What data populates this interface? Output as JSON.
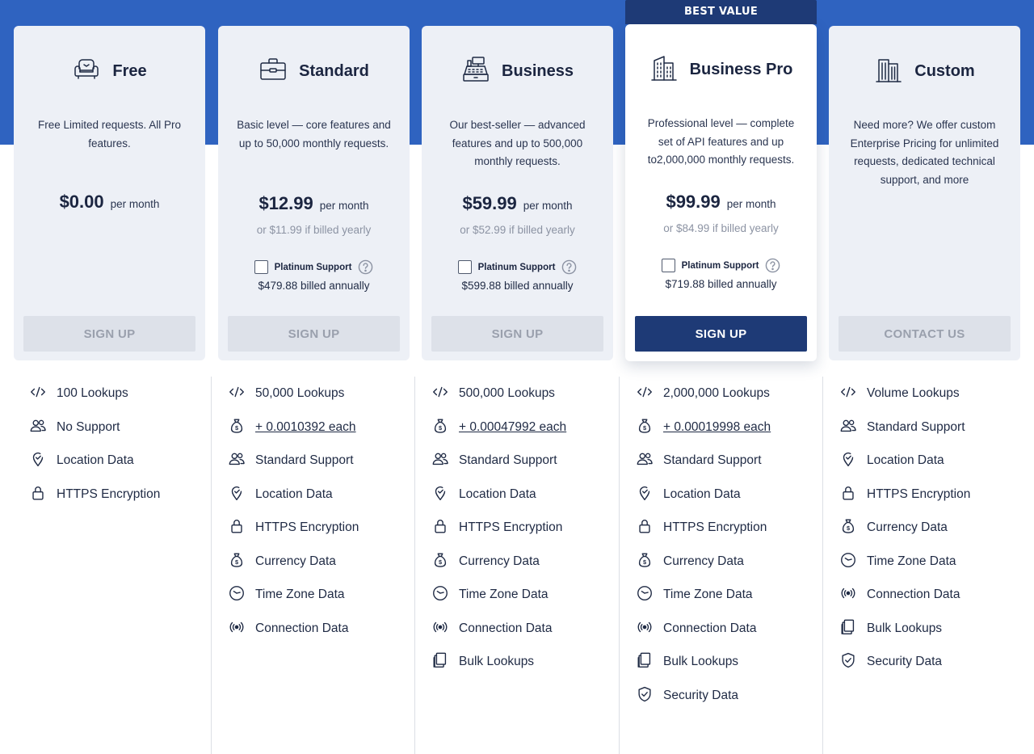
{
  "banner": {
    "best_value": "BEST VALUE"
  },
  "plans": [
    {
      "name": "Free",
      "icon": "armchair-icon",
      "description": "Free Limited requests. All Pro features.",
      "price": "$0.00",
      "period": "per month",
      "yearly": "",
      "support_label": "",
      "annual": "",
      "button": "SIGN UP",
      "features": [
        {
          "icon": "code-icon",
          "text": "100 Lookups"
        },
        {
          "icon": "users-icon",
          "text": "No Support"
        },
        {
          "icon": "location-icon",
          "text": "Location Data"
        },
        {
          "icon": "lock-icon",
          "text": "HTTPS Encryption"
        }
      ]
    },
    {
      "name": "Standard",
      "icon": "briefcase-icon",
      "description": "Basic level — core features and up to 50,000 monthly requests.",
      "price": "$12.99",
      "period": "per month",
      "yearly": "or $11.99 if billed yearly",
      "support_label": "Platinum Support",
      "annual": "$479.88 billed annually",
      "button": "SIGN UP",
      "features": [
        {
          "icon": "code-icon",
          "text": "50,000 Lookups"
        },
        {
          "icon": "money-bag-icon",
          "text": "+ 0.0010392 each",
          "link": true
        },
        {
          "icon": "users-icon",
          "text": "Standard Support"
        },
        {
          "icon": "location-icon",
          "text": "Location Data"
        },
        {
          "icon": "lock-icon",
          "text": "HTTPS Encryption"
        },
        {
          "icon": "money-bag-icon",
          "text": "Currency Data"
        },
        {
          "icon": "clock-icon",
          "text": "Time Zone Data"
        },
        {
          "icon": "signal-icon",
          "text": "Connection Data"
        }
      ]
    },
    {
      "name": "Business",
      "icon": "cash-register-icon",
      "description": "Our best-seller — advanced features and up to 500,000 monthly requests.",
      "price": "$59.99",
      "period": "per month",
      "yearly": "or $52.99 if billed yearly",
      "support_label": "Platinum Support",
      "annual": "$599.88 billed annually",
      "button": "SIGN UP",
      "features": [
        {
          "icon": "code-icon",
          "text": "500,000 Lookups"
        },
        {
          "icon": "money-bag-icon",
          "text": "+ 0.00047992 each",
          "link": true
        },
        {
          "icon": "users-icon",
          "text": "Standard Support"
        },
        {
          "icon": "location-icon",
          "text": "Location Data"
        },
        {
          "icon": "lock-icon",
          "text": "HTTPS Encryption"
        },
        {
          "icon": "money-bag-icon",
          "text": "Currency Data"
        },
        {
          "icon": "clock-icon",
          "text": "Time Zone Data"
        },
        {
          "icon": "signal-icon",
          "text": "Connection Data"
        },
        {
          "icon": "documents-icon",
          "text": "Bulk Lookups"
        }
      ]
    },
    {
      "name": "Business Pro",
      "icon": "building-icon",
      "description": "Professional level — complete set of API features and up to2,000,000 monthly requests.",
      "price": "$99.99",
      "period": "per month",
      "yearly": "or $84.99 if billed yearly",
      "support_label": "Platinum Support",
      "annual": "$719.88 billed annually",
      "button": "SIGN UP",
      "featured": true,
      "features": [
        {
          "icon": "code-icon",
          "text": "2,000,000 Lookups"
        },
        {
          "icon": "money-bag-icon",
          "text": "+ 0.00019998 each",
          "link": true
        },
        {
          "icon": "users-icon",
          "text": "Standard Support"
        },
        {
          "icon": "location-icon",
          "text": "Location Data"
        },
        {
          "icon": "lock-icon",
          "text": "HTTPS Encryption"
        },
        {
          "icon": "money-bag-icon",
          "text": "Currency Data"
        },
        {
          "icon": "clock-icon",
          "text": "Time Zone Data"
        },
        {
          "icon": "signal-icon",
          "text": "Connection Data"
        },
        {
          "icon": "documents-icon",
          "text": "Bulk Lookups"
        },
        {
          "icon": "shield-icon",
          "text": "Security Data"
        }
      ]
    },
    {
      "name": "Custom",
      "icon": "skyscraper-icon",
      "description": "Need more? We offer custom Enterprise Pricing for unlimited requests, dedicated technical support, and more",
      "price": "",
      "period": "",
      "yearly": "",
      "support_label": "",
      "annual": "",
      "button": "CONTACT US",
      "features": [
        {
          "icon": "code-icon",
          "text": "Volume Lookups"
        },
        {
          "icon": "users-icon",
          "text": "Standard Support"
        },
        {
          "icon": "location-icon",
          "text": "Location Data"
        },
        {
          "icon": "lock-icon",
          "text": "HTTPS Encryption"
        },
        {
          "icon": "money-bag-icon",
          "text": "Currency Data"
        },
        {
          "icon": "clock-icon",
          "text": "Time Zone Data"
        },
        {
          "icon": "signal-icon",
          "text": "Connection Data"
        },
        {
          "icon": "documents-icon",
          "text": "Bulk Lookups"
        },
        {
          "icon": "shield-icon",
          "text": "Security Data"
        }
      ]
    }
  ],
  "colors": {
    "band": "#2f63c0",
    "card": "#edf0f6",
    "primary": "#1e3a76",
    "button_disabled": "#dde1e9",
    "muted_text": "#8c93a3"
  }
}
